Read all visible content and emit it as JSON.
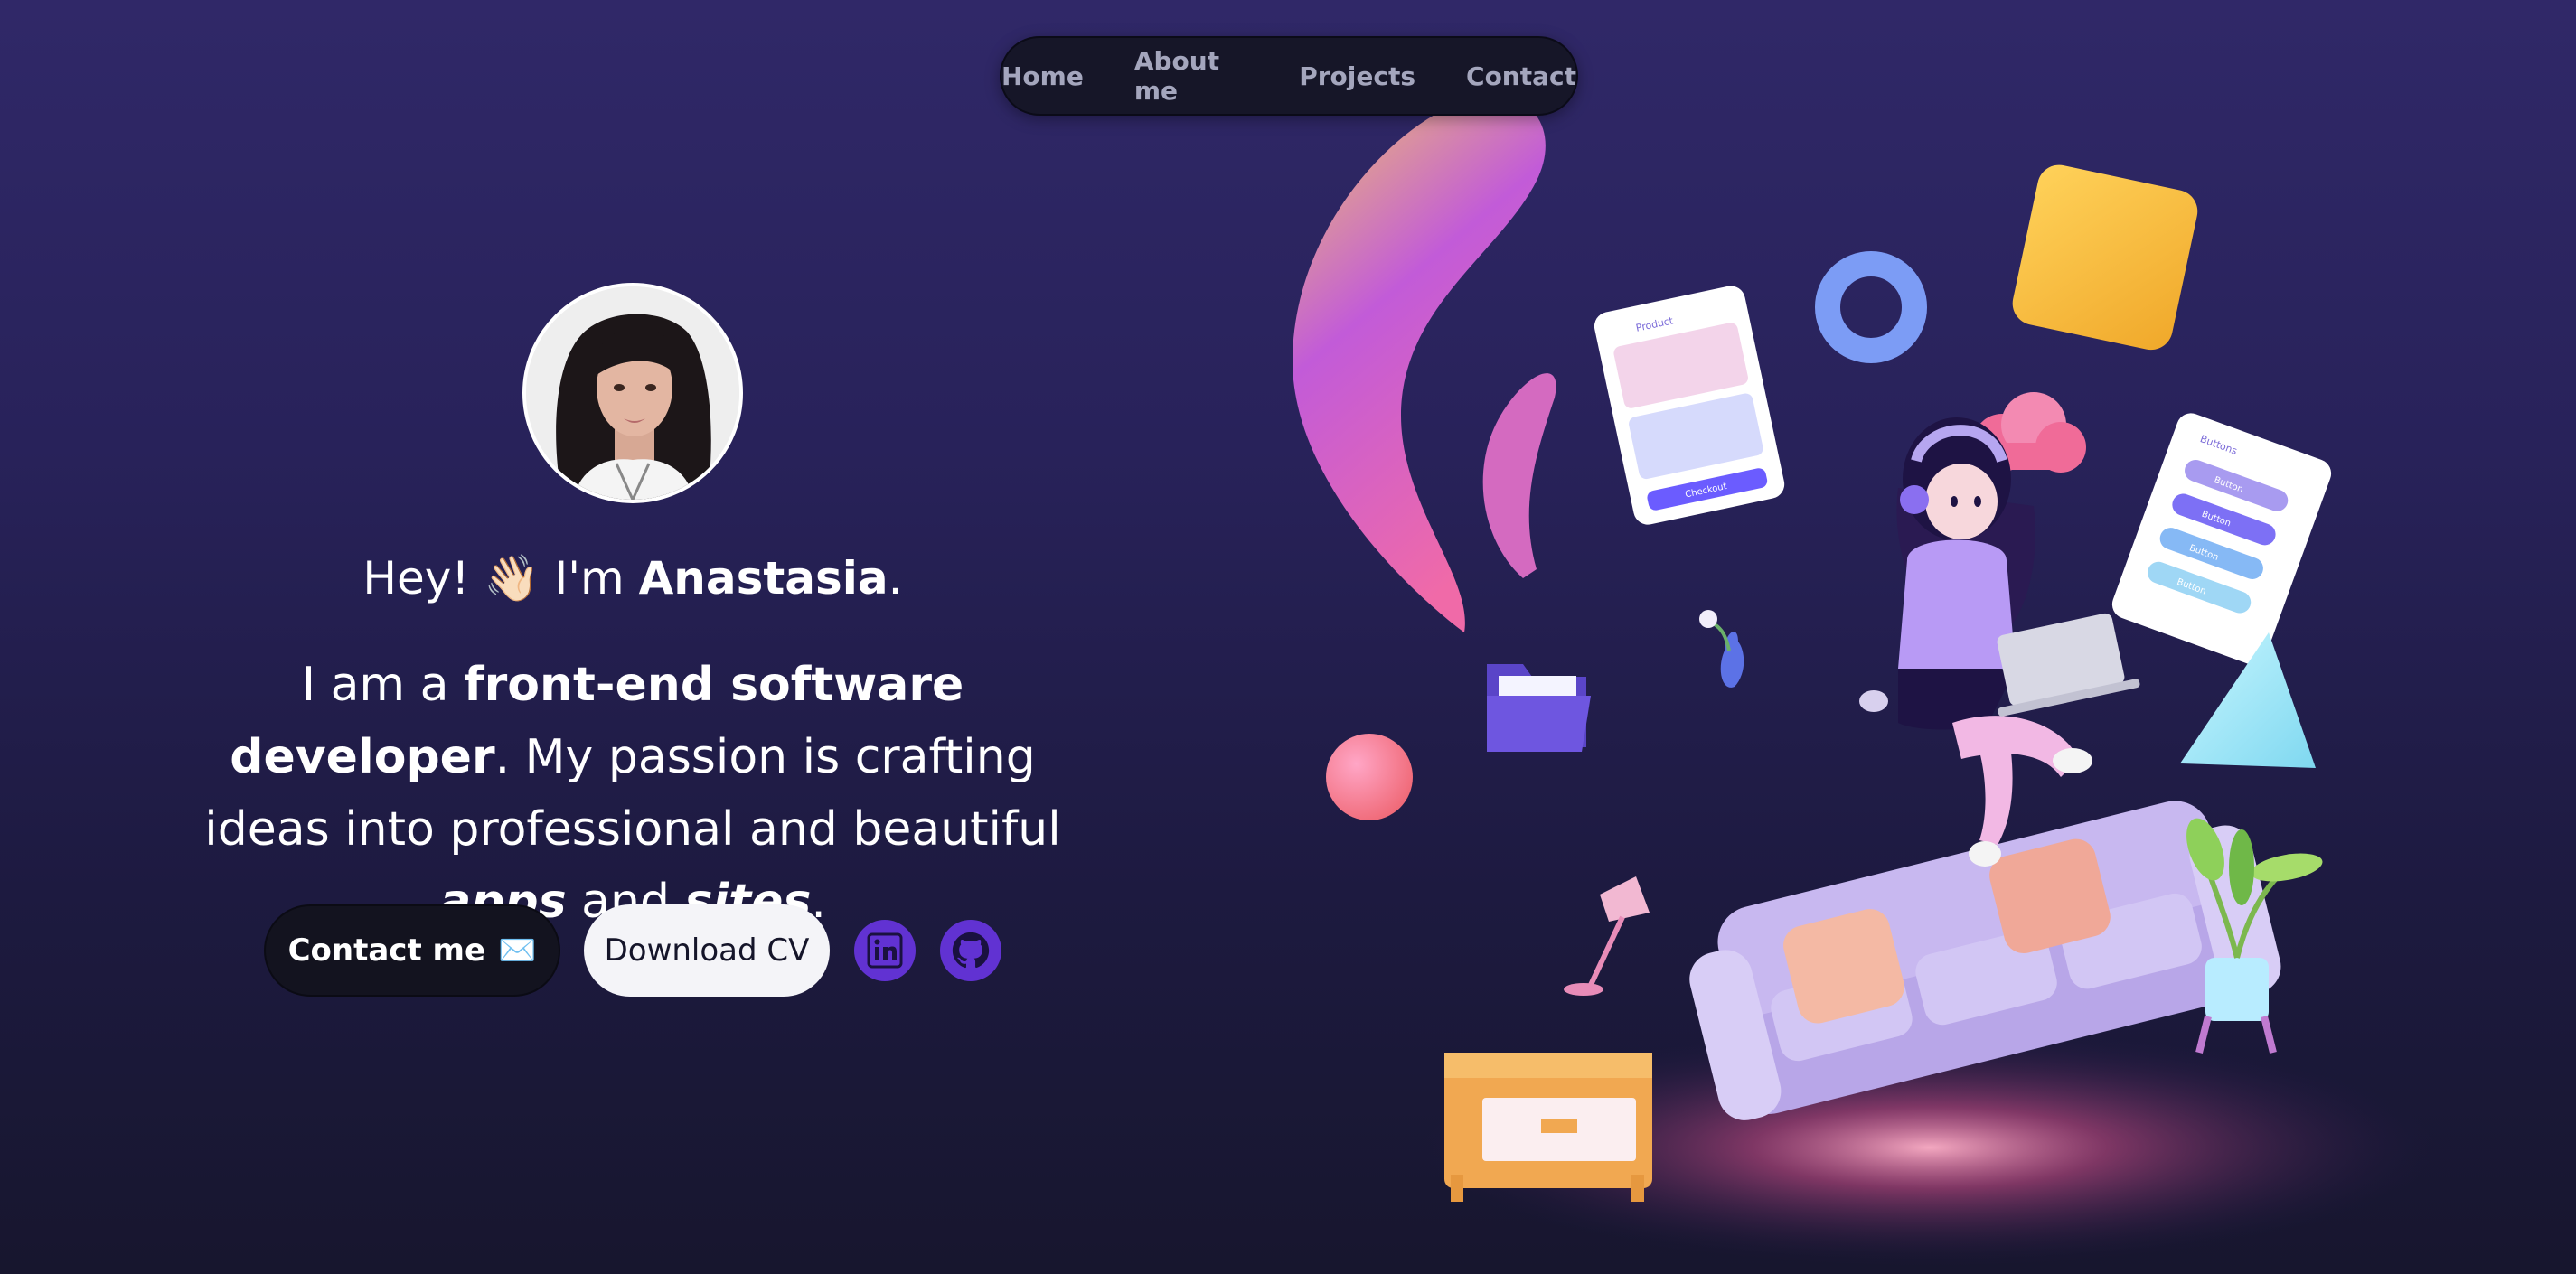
{
  "nav": {
    "items": [
      {
        "label": "Home"
      },
      {
        "label": "About me"
      },
      {
        "label": "Projects"
      },
      {
        "label": "Contact"
      }
    ]
  },
  "hero": {
    "greeting": {
      "prefix": "Hey!",
      "wave": "👋🏻",
      "im": "I'm",
      "name": "Anastasia",
      "end": "."
    },
    "tagline": {
      "t1": "I am a",
      "b1": "front-end software developer",
      "t2": ". My passion is crafting ideas into professional and beautiful",
      "i1": "apps",
      "t3": "and",
      "i2": "sites",
      "t4": "."
    },
    "buttons": {
      "contact_label": "Contact me",
      "contact_icon": "✉️",
      "cv_label": "Download CV"
    },
    "social": {
      "linkedin_icon": "linkedin-icon",
      "github_icon": "github-icon"
    }
  },
  "colors": {
    "accent": "#6132d2",
    "background_top": "#302868",
    "background_bottom": "#17162e",
    "nav_bg": "#161628"
  },
  "illustration": {
    "screen_a": {
      "title": "Product",
      "button": "Checkout"
    },
    "screen_b": {
      "title": "Buttons",
      "buttons": [
        "Button",
        "Button",
        "Button",
        "Button"
      ]
    }
  }
}
